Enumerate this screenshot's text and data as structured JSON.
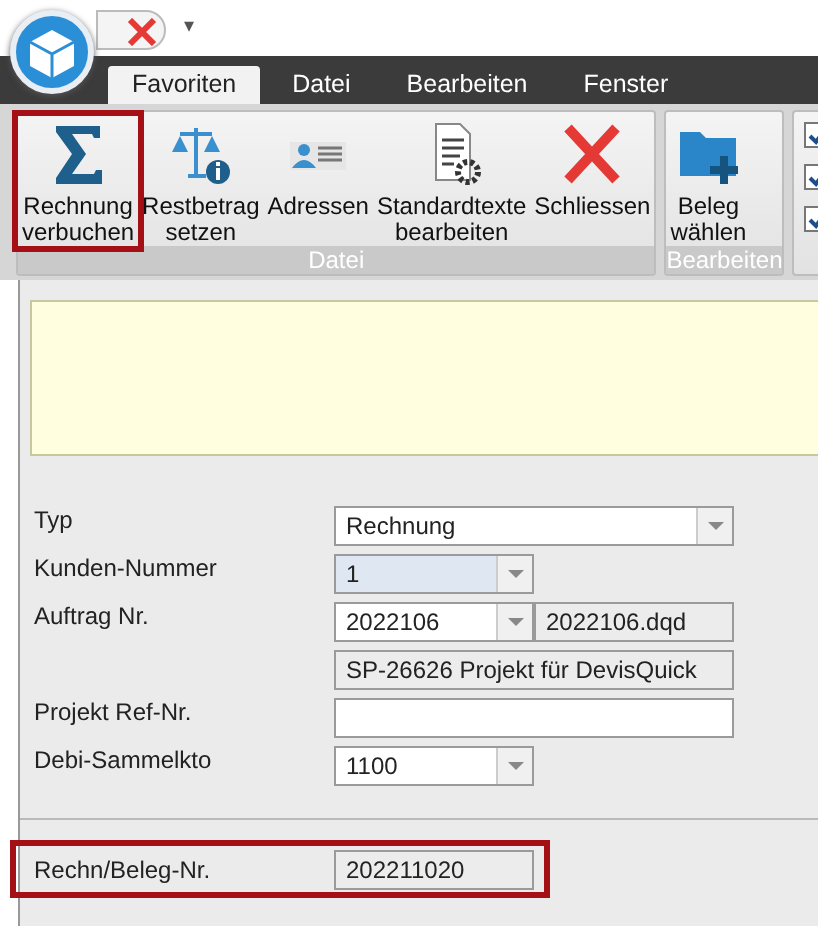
{
  "quick_access": {
    "dropdown": "▾"
  },
  "tabs": [
    {
      "label": "Favoriten",
      "selected": true
    },
    {
      "label": "Datei",
      "selected": false
    },
    {
      "label": "Bearbeiten",
      "selected": false
    },
    {
      "label": "Fenster",
      "selected": false
    }
  ],
  "ribbon_groups": [
    {
      "label": "Datei",
      "buttons": [
        {
          "label": "Rechnung verbuchen",
          "highlighted": true
        },
        {
          "label": "Restbetrag setzen",
          "highlighted": false
        },
        {
          "label": "Adressen",
          "highlighted": false
        },
        {
          "label": "Standardtexte bearbeiten",
          "highlighted": false
        },
        {
          "label": "Schliessen",
          "highlighted": false
        }
      ]
    },
    {
      "label": "Bearbeiten",
      "buttons": [
        {
          "label": "Beleg wählen",
          "highlighted": false
        }
      ]
    }
  ],
  "ribbon_checkboxes": [
    {
      "checked": true
    },
    {
      "checked": true
    },
    {
      "checked": true
    }
  ],
  "form": {
    "fields": [
      {
        "label": "Typ",
        "kind": "combo_wide",
        "value": "Rechnung",
        "focused": false
      },
      {
        "label": "Kunden-Nummer",
        "kind": "combo_narrow",
        "value": "1",
        "focused": true
      },
      {
        "label": "Auftrag Nr.",
        "kind": "combo_file",
        "value": "2022106",
        "file": "2022106.dqd",
        "focused": false
      },
      {
        "kind": "readonly",
        "value": "SP-26626 Projekt für DevisQuick"
      },
      {
        "label": "Projekt Ref-Nr.",
        "kind": "text"
      },
      {
        "label": "Debi-Sammelkto",
        "kind": "combo_narrow",
        "value": "1100",
        "focused": false
      }
    ],
    "footer_field": {
      "label": "Rechn/Beleg-Nr.",
      "value": "202211020",
      "highlighted": true
    }
  }
}
